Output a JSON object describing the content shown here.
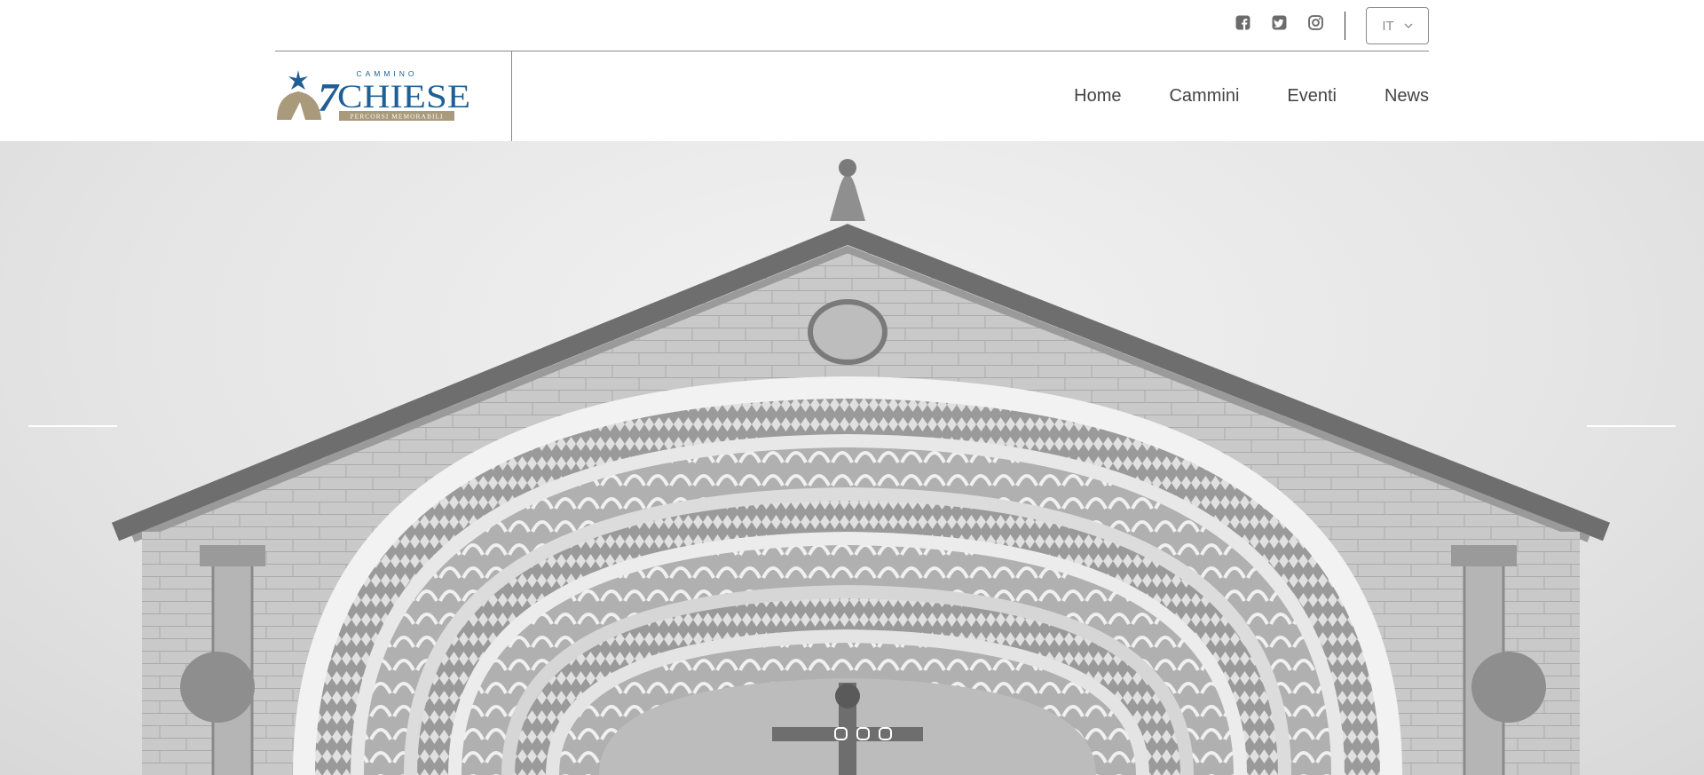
{
  "topbar": {
    "socials": [
      {
        "name": "facebook",
        "icon": "facebook-square-icon"
      },
      {
        "name": "twitter",
        "icon": "twitter-square-icon"
      },
      {
        "name": "instagram",
        "icon": "instagram-icon"
      }
    ],
    "language": {
      "selected": "IT"
    }
  },
  "header": {
    "logo": {
      "line1": "CAMMINO",
      "number": "7",
      "word": "CHIESE",
      "tagline": "PERCORSI MEMORABILI"
    },
    "nav": {
      "home": "Home",
      "cammini": "Cammini",
      "eventi": "Eventi",
      "news": "News"
    }
  },
  "hero": {
    "slide_count": 3,
    "active_slide": 1,
    "image_subject": "church-facade-portal"
  },
  "colors": {
    "logo_blue": "#1f5f95",
    "logo_gold": "#a89a7a",
    "text": "#444444",
    "divider": "#8a8a8a"
  }
}
